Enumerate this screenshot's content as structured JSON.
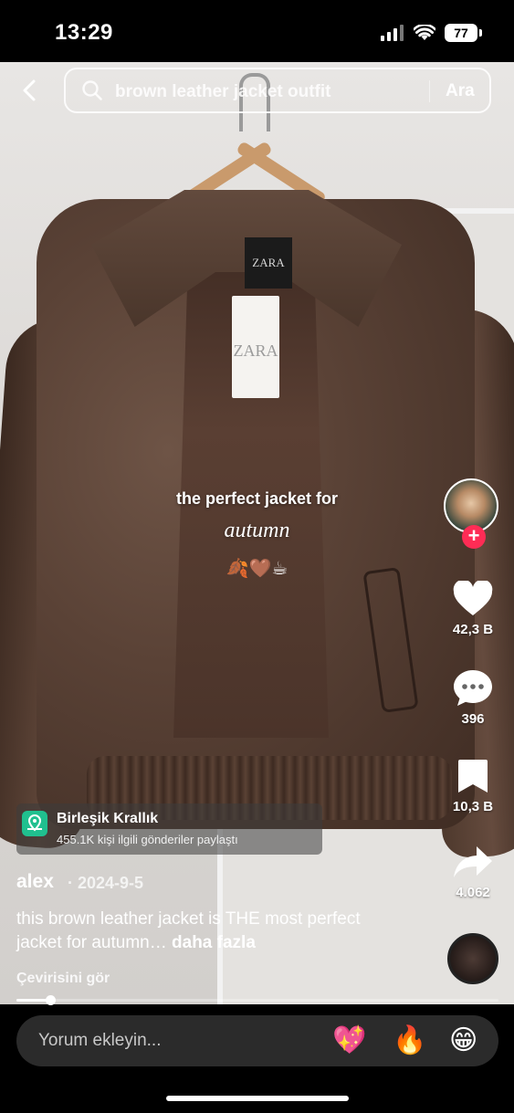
{
  "status_bar": {
    "time": "13:29",
    "battery": "77"
  },
  "search": {
    "query": "brown leather jacket outfit",
    "button": "Ara"
  },
  "video_overlay": {
    "line1": "the perfect jacket for",
    "line2": "autumn",
    "emoji": "🍂🤎☕"
  },
  "product_labels": {
    "neck_label": "ZARA",
    "tag": "ZARA"
  },
  "actions": {
    "likes": "42,3 B",
    "comments": "396",
    "saves": "10,3 B",
    "shares": "4.062",
    "follow": "+"
  },
  "location": {
    "title": "Birleşik Krallık",
    "subtitle": "455.1K kişi ilgili gönderiler paylaştı"
  },
  "post": {
    "username": "alex",
    "date": "· 2024-9-5",
    "caption": "this brown leather jacket is THE most perfect jacket for autumn…",
    "more": "daha fazla",
    "translate": "Çevirisini gör",
    "progress": 0.07
  },
  "comment_bar": {
    "placeholder": "Yorum ekleyin...",
    "emojis": [
      "💖",
      "🔥",
      "😁"
    ]
  }
}
